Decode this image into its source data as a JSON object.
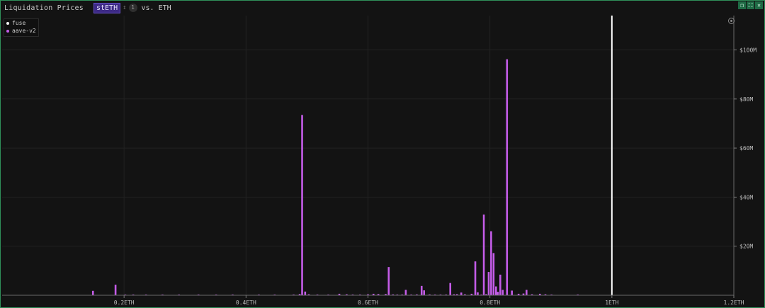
{
  "header": {
    "title": "Liquidation Prices",
    "token": "stETH",
    "swap_icon": "swap-icon",
    "count": "1",
    "vs_label": "vs. ETH"
  },
  "window_controls": [
    "restore-icon",
    "maximize-icon",
    "close-icon"
  ],
  "legend": {
    "placement": "top-left",
    "items": [
      {
        "label": "fuse",
        "color": "#f2f2f2"
      },
      {
        "label": "aave-v2",
        "color": "#c45ce8"
      }
    ]
  },
  "chart_data": {
    "type": "bar",
    "title": "",
    "xlabel": "",
    "ylabel": "",
    "x_unit": "ETH",
    "xlim": [
      0,
      1.2
    ],
    "ylim": [
      0,
      114000000
    ],
    "x_ticks": [
      "0.2ETH",
      "0.4ETH",
      "0.6ETH",
      "0.8ETH",
      "1ETH",
      "1.2ETH"
    ],
    "x_tick_values": [
      0.2,
      0.4,
      0.6,
      0.8,
      1.0,
      1.2
    ],
    "y_ticks": [
      "$20M",
      "$40M",
      "$60M",
      "$80M",
      "$100M"
    ],
    "y_tick_values": [
      20000000,
      40000000,
      60000000,
      80000000,
      100000000
    ],
    "grid": true,
    "reference_line": {
      "x": 1.0,
      "color": "#ffffff"
    },
    "series": [
      {
        "name": "aave-v2",
        "color": "#c45ce8",
        "points": [
          [
            0.149,
            1800000
          ],
          [
            0.186,
            4300000
          ],
          [
            0.202,
            200000
          ],
          [
            0.215,
            300000
          ],
          [
            0.236,
            250000
          ],
          [
            0.263,
            250000
          ],
          [
            0.29,
            200000
          ],
          [
            0.322,
            300000
          ],
          [
            0.351,
            200000
          ],
          [
            0.378,
            300000
          ],
          [
            0.421,
            250000
          ],
          [
            0.447,
            200000
          ],
          [
            0.478,
            300000
          ],
          [
            0.488,
            500000
          ],
          [
            0.492,
            73500000
          ],
          [
            0.497,
            1500000
          ],
          [
            0.503,
            400000
          ],
          [
            0.517,
            300000
          ],
          [
            0.535,
            250000
          ],
          [
            0.553,
            600000
          ],
          [
            0.565,
            400000
          ],
          [
            0.575,
            300000
          ],
          [
            0.587,
            300000
          ],
          [
            0.6,
            400000
          ],
          [
            0.609,
            600000
          ],
          [
            0.617,
            500000
          ],
          [
            0.629,
            500000
          ],
          [
            0.634,
            11500000
          ],
          [
            0.641,
            350000
          ],
          [
            0.648,
            300000
          ],
          [
            0.656,
            300000
          ],
          [
            0.662,
            2200000
          ],
          [
            0.671,
            300000
          ],
          [
            0.68,
            350000
          ],
          [
            0.688,
            3800000
          ],
          [
            0.692,
            2000000
          ],
          [
            0.701,
            350000
          ],
          [
            0.71,
            300000
          ],
          [
            0.719,
            300000
          ],
          [
            0.728,
            300000
          ],
          [
            0.735,
            5000000
          ],
          [
            0.741,
            400000
          ],
          [
            0.746,
            450000
          ],
          [
            0.753,
            1100000
          ],
          [
            0.759,
            400000
          ],
          [
            0.77,
            600000
          ],
          [
            0.776,
            13800000
          ],
          [
            0.78,
            1200000
          ],
          [
            0.786,
            250000
          ],
          [
            0.79,
            32900000
          ],
          [
            0.794,
            450000
          ],
          [
            0.798,
            9500000
          ],
          [
            0.802,
            26100000
          ],
          [
            0.806,
            17200000
          ],
          [
            0.81,
            3600000
          ],
          [
            0.813,
            1400000
          ],
          [
            0.817,
            8400000
          ],
          [
            0.821,
            2200000
          ],
          [
            0.828,
            96200000
          ],
          [
            0.836,
            1900000
          ],
          [
            0.847,
            600000
          ],
          [
            0.855,
            700000
          ],
          [
            0.86,
            2200000
          ],
          [
            0.869,
            400000
          ],
          [
            0.882,
            600000
          ],
          [
            0.891,
            400000
          ],
          [
            0.901,
            300000
          ],
          [
            0.944,
            300000
          ]
        ]
      },
      {
        "name": "fuse",
        "color": "#f2f2f2",
        "points": []
      }
    ]
  }
}
